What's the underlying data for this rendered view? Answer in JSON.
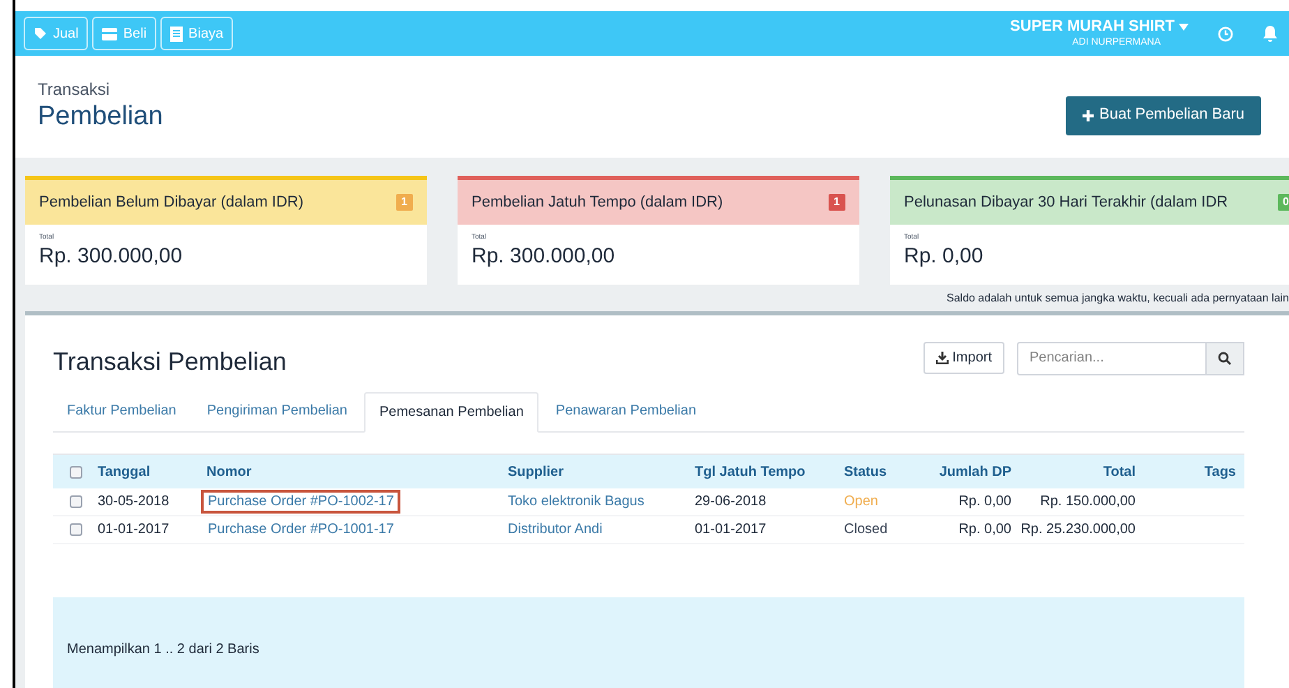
{
  "top_bar": {
    "buttons": [
      {
        "kind": "tag",
        "label": "Jual"
      },
      {
        "kind": "card",
        "label": "Beli"
      },
      {
        "kind": "doc",
        "label": "Biaya"
      }
    ],
    "company": "SUPER MURAH SHIRT",
    "user": "ADI NURPERMANA"
  },
  "header": {
    "breadcrumb": "Transaksi",
    "title": "Pembelian",
    "action": "Buat Pembelian Baru"
  },
  "cards": [
    {
      "title": "Pembelian Belum Dibayar (dalam IDR)",
      "count": "1",
      "color": "#f0ad4e",
      "caption": "Total",
      "amount": "Rp. 300.000,00"
    },
    {
      "title": "Pembelian Jatuh Tempo (dalam IDR)",
      "count": "1",
      "color": "#d9534f",
      "caption": "Total",
      "amount": "Rp. 300.000,00"
    },
    {
      "title": "Pelunasan Dibayar 30 Hari Terakhir (dalam IDR",
      "count": "0",
      "color": "#5cb85c",
      "caption": "Total",
      "amount": "Rp. 0,00"
    }
  ],
  "note": "Saldo adalah untuk semua jangka waktu, kecuali ada pernyataan lain",
  "panel": {
    "title": "Transaksi Pembelian",
    "import": "Import",
    "search": {
      "placeholder": "Pencarian..."
    },
    "tabs": [
      {
        "label": "Faktur Pembelian",
        "selected": false
      },
      {
        "label": "Pengiriman Pembelian",
        "selected": false
      },
      {
        "label": "Pemesanan Pembelian",
        "selected": true
      },
      {
        "label": "Penawaran Pembelian",
        "selected": false
      }
    ],
    "table": {
      "columns": [
        "Tanggal",
        "Nomor",
        "Supplier",
        "Tgl Jatuh Tempo",
        "Status",
        "Jumlah DP",
        "Total",
        "Tags"
      ],
      "select_all_checked": false,
      "rows": [
        {
          "checked": false,
          "date": "30-05-2018",
          "number": "Purchase Order #PO-1002-17",
          "highlighted": true,
          "supplier": "Toko elektronik Bagus",
          "due": "29-06-2018",
          "status": "Open",
          "kind": "open",
          "dp": "Rp. 0,00",
          "total": "Rp. 150.000,00"
        },
        {
          "checked": false,
          "date": "01-01-2017",
          "number": "Purchase Order #PO-1001-17",
          "highlighted": false,
          "supplier": "Distributor Andi",
          "due": "01-01-2017",
          "status": "Closed",
          "kind": "closed",
          "dp": "Rp. 0,00",
          "total": "Rp. 25.230.000,00"
        }
      ]
    },
    "footer": "Menampilkan 1 .. 2 dari 2 Baris"
  }
}
